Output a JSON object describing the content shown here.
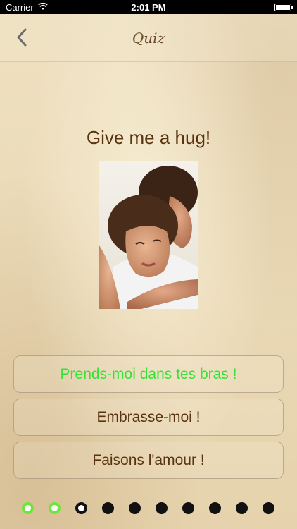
{
  "status_bar": {
    "carrier": "Carrier",
    "time": "2:01 PM"
  },
  "nav": {
    "title": "Quiz",
    "back_icon": "chevron-left-icon"
  },
  "question": {
    "prompt": "Give me a hug!"
  },
  "answers": [
    {
      "label": "Prends-moi dans tes bras !",
      "state": "correct"
    },
    {
      "label": "Embrasse-moi !",
      "state": "normal"
    },
    {
      "label": "Faisons l'amour !",
      "state": "normal"
    }
  ],
  "progress": {
    "total": 10,
    "states": [
      "done",
      "done",
      "current",
      "pending",
      "pending",
      "pending",
      "pending",
      "pending",
      "pending",
      "pending"
    ]
  },
  "colors": {
    "correct_answer": "#33e233",
    "completed_dot": "#6ee63a",
    "text_brown": "#5a3410"
  }
}
